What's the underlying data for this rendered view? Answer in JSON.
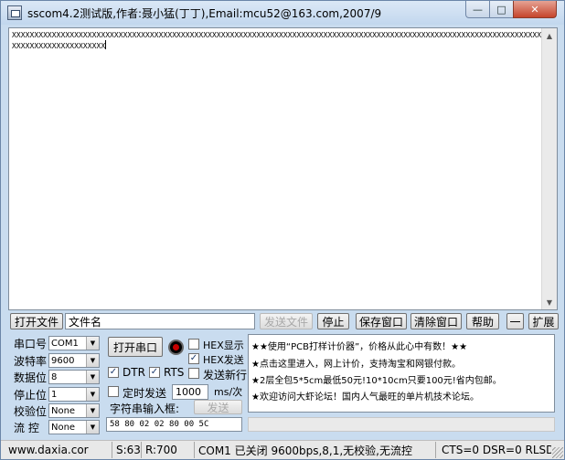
{
  "window": {
    "title": "sscom4.2测试版,作者:聂小猛(丁丁),Email:mcu52@163.com,2007/9",
    "minimize": "—",
    "maximize": "□",
    "close": "✕"
  },
  "receive": {
    "text": "XXXXXXXXXXXXXXXXXXXXXXXXXXXXXXXXXXXXXXXXXXXXXXXXXXXXXXXXXXXXXXXXXXXXXXXXXXXXXXXXXXXXXXXXXXXXXXXXXXXXXXXXXXXXXXXXXXXXXXXXXXXXXXXXXXXXXXXXXXXX"
  },
  "toolbar": {
    "open_file": "打开文件",
    "file_name": "文件名",
    "send_file": "发送文件",
    "stop": "停止",
    "save_window": "保存窗口",
    "clear_window": "清除窗口",
    "help": "帮助",
    "collapse": "一",
    "expand": "扩展"
  },
  "settings": {
    "port_label": "串口号",
    "port_value": "COM1",
    "baud_label": "波特率",
    "baud_value": "9600",
    "databits_label": "数据位",
    "databits_value": "8",
    "stopbits_label": "停止位",
    "stopbits_value": "1",
    "parity_label": "校验位",
    "parity_value": "None",
    "flow_label": "流 控",
    "flow_value": "None"
  },
  "controls": {
    "open_port": "打开串口",
    "hex_display": "HEX显示",
    "hex_send": "HEX发送",
    "dtr": "DTR",
    "rts": "RTS",
    "send_newline": "发送新行",
    "timed_send": "定时发送",
    "interval": "1000",
    "interval_unit": "ms/次",
    "string_input": "字符串输入框:",
    "send": "发送",
    "hex_input": "58 80 02 02 80 00 5C",
    "check_mark": "✓"
  },
  "ads": [
    "★★使用“PCB打样计价器”，价格从此心中有数！★★",
    "★点击这里进入，网上计价，支持淘宝和网银付款。",
    "★2层全包5*5cm最低50元!10*10cm只要100元!省内包邮。",
    "★欢迎访问大虾论坛！国内人气最旺的单片机技术论坛。"
  ],
  "status": {
    "site": "www.daxia.cor",
    "sent": "S:63",
    "received": "R:700",
    "port_state": "COM1 已关闭  9600bps,8,1,无校验,无流控",
    "lines": "CTS=0 DSR=0 RLSD"
  },
  "icons": {
    "scroll_up": "▲",
    "scroll_down": "▼",
    "dropdown": "▼"
  }
}
